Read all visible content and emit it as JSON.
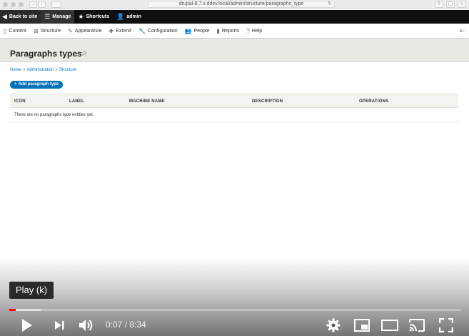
{
  "browser": {
    "url": "drupal-8.7.x.ddev.local/admin/structure/paragraphs_type"
  },
  "toolbar": {
    "back_label": "Back to site",
    "manage_label": "Manage",
    "shortcuts_label": "Shortcuts",
    "user_label": "admin"
  },
  "tray": {
    "items": [
      {
        "label": "Content",
        "icon": "file-icon"
      },
      {
        "label": "Structure",
        "icon": "sitemap-icon"
      },
      {
        "label": "Appearance",
        "icon": "brush-icon"
      },
      {
        "label": "Extend",
        "icon": "puzzle-icon"
      },
      {
        "label": "Configuration",
        "icon": "wrench-icon"
      },
      {
        "label": "People",
        "icon": "people-icon"
      },
      {
        "label": "Reports",
        "icon": "bar-chart-icon"
      },
      {
        "label": "Help",
        "icon": "help-icon"
      }
    ]
  },
  "page": {
    "title": "Paragraphs types",
    "breadcrumb": [
      "Home",
      "Administration",
      "Structure"
    ],
    "add_button": "Add paragraph type"
  },
  "table": {
    "headers": [
      "ICON",
      "LABEL",
      "MACHINE NAME",
      "DESCRIPTION",
      "OPERATIONS"
    ],
    "empty_message": "There are no paragraphs type entities yet."
  },
  "player": {
    "tooltip": "Play (k)",
    "current_time": "0:07",
    "duration": "8:34",
    "time_display": "0:07 / 8:34",
    "played_fraction": 0.014,
    "buffered_fraction": 0.07,
    "accent": "#ff0000"
  }
}
